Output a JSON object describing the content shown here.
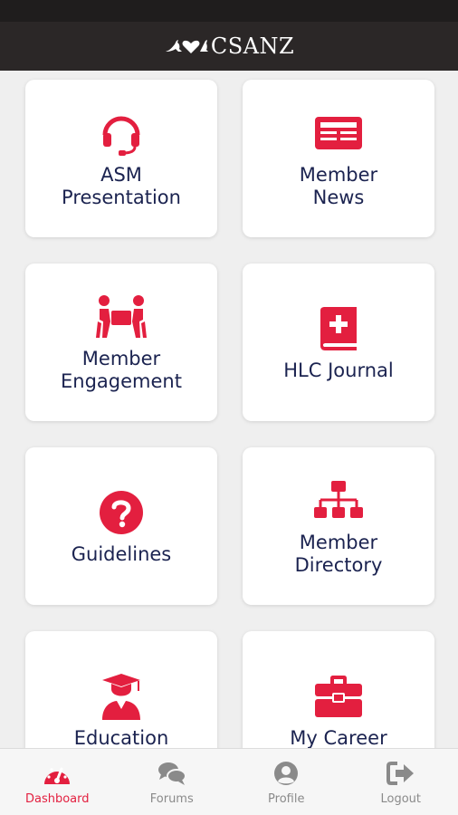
{
  "app": {
    "brand": "CSANZ",
    "accent": "#e31f3f",
    "text_color": "#1b2350"
  },
  "tiles": [
    {
      "label": "ASM\nPresentation",
      "icon": "headset-icon"
    },
    {
      "label": "Member\nNews",
      "icon": "newspaper-icon"
    },
    {
      "label": "Member\nEngagement",
      "icon": "people-carry-icon"
    },
    {
      "label": "HLC Journal",
      "icon": "medical-book-icon"
    },
    {
      "label": "Guidelines",
      "icon": "question-circle-icon"
    },
    {
      "label": "Member\nDirectory",
      "icon": "sitemap-icon"
    },
    {
      "label": "Education",
      "icon": "graduate-icon"
    },
    {
      "label": "My Career",
      "icon": "toolbox-icon"
    }
  ],
  "bottom_nav": [
    {
      "label": "Dashboard",
      "icon": "dashboard-icon",
      "active": true
    },
    {
      "label": "Forums",
      "icon": "comments-icon",
      "active": false
    },
    {
      "label": "Profile",
      "icon": "user-circle-icon",
      "active": false
    },
    {
      "label": "Logout",
      "icon": "logout-icon",
      "active": false
    }
  ]
}
